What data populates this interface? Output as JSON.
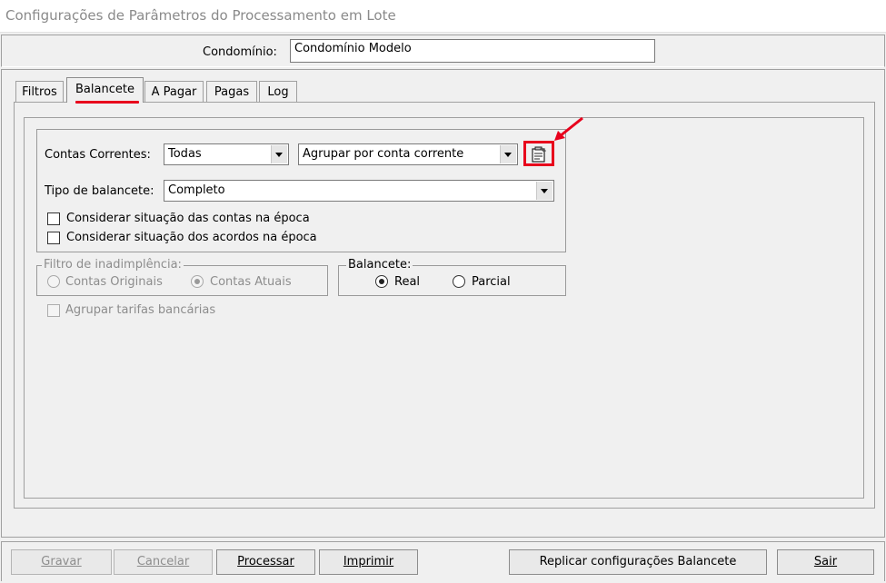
{
  "window": {
    "title": "Configurações de Parâmetros do Processamento em Lote"
  },
  "header": {
    "condominio_label": "Condomínio:",
    "condominio_value": "Condomínio Modelo"
  },
  "tabs": [
    {
      "label": "Filtros",
      "active": false
    },
    {
      "label": "Balancete",
      "active": true
    },
    {
      "label": "A Pagar",
      "active": false
    },
    {
      "label": "Pagas",
      "active": false
    },
    {
      "label": "Log",
      "active": false
    }
  ],
  "balancete_tab": {
    "contas_correntes_label": "Contas Correntes:",
    "contas_correntes_value": "Todas",
    "agrupar_value": "Agrupar por conta corrente",
    "config_button_icon": "clipboard-settings-icon",
    "tipo_balancete_label": "Tipo de balancete:",
    "tipo_balancete_value": "Completo",
    "checkbox_situacao_contas": {
      "label": "Considerar situação das contas na época",
      "checked": false
    },
    "checkbox_situacao_acordos": {
      "label": "Considerar situação dos acordos na época",
      "checked": false
    },
    "filtro_inadimplencia": {
      "title": "Filtro de inadimplência:",
      "options": [
        {
          "label": "Contas Originais",
          "checked": false
        },
        {
          "label": "Contas Atuais",
          "checked": true
        }
      ],
      "enabled": false
    },
    "balancete_group": {
      "title": "Balancete:",
      "options": [
        {
          "label": "Real",
          "checked": true
        },
        {
          "label": "Parcial",
          "checked": false
        }
      ]
    },
    "checkbox_agrupar_tarifas": {
      "label": "Agrupar tarifas bancárias",
      "checked": false,
      "enabled": false
    }
  },
  "buttons": {
    "gravar": "Gravar",
    "cancelar": "Cancelar",
    "processar": "Processar",
    "imprimir": "Imprimir",
    "replicar": "Replicar configurações Balancete",
    "sair": "Sair"
  },
  "colors": {
    "highlight": "#e8001c",
    "background": "#f0f0f0"
  }
}
